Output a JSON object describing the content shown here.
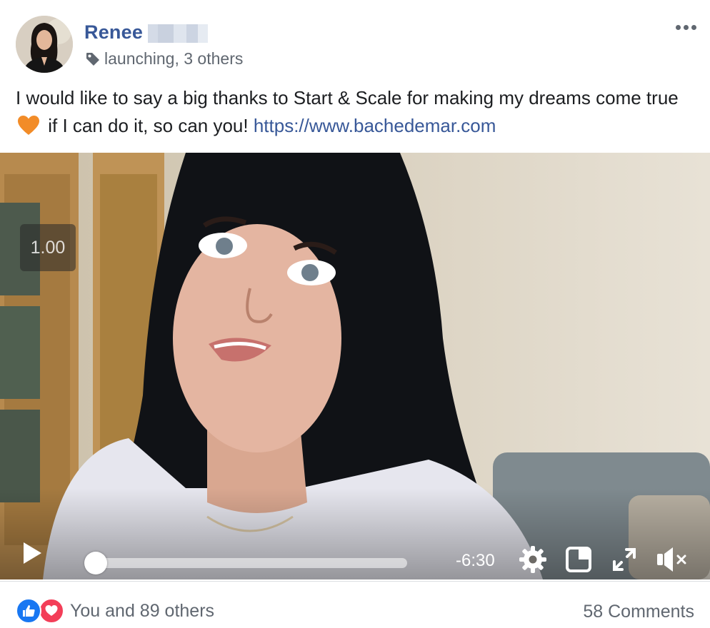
{
  "post": {
    "author": "Renee",
    "tagline": "launching, 3 others",
    "text_before_emoji": "I would like to say a big thanks to Start & Scale for making my dreams come true",
    "text_after_emoji": " if I can do it, so can you! ",
    "link": "https://www.bachedemar.com",
    "emoji": "orange-heart",
    "icons": {
      "options": "more-options-icon",
      "tag": "tag-icon"
    }
  },
  "video": {
    "speed_label": "1.00",
    "time_remaining": "-6:30",
    "progress": 0.0,
    "icons": [
      "play-icon",
      "gear-icon",
      "picture-in-picture-icon",
      "fullscreen-icon",
      "muted-speaker-icon"
    ]
  },
  "footer": {
    "reactions_text": "You and 89 others",
    "comments_text": "58 Comments",
    "reaction_icons": [
      "like-icon",
      "love-icon"
    ]
  },
  "colors": {
    "link": "#385898",
    "secondary_text": "#606770",
    "like": "#1877f2",
    "love": "#f33e58",
    "heart_emoji": "#f28c28"
  }
}
